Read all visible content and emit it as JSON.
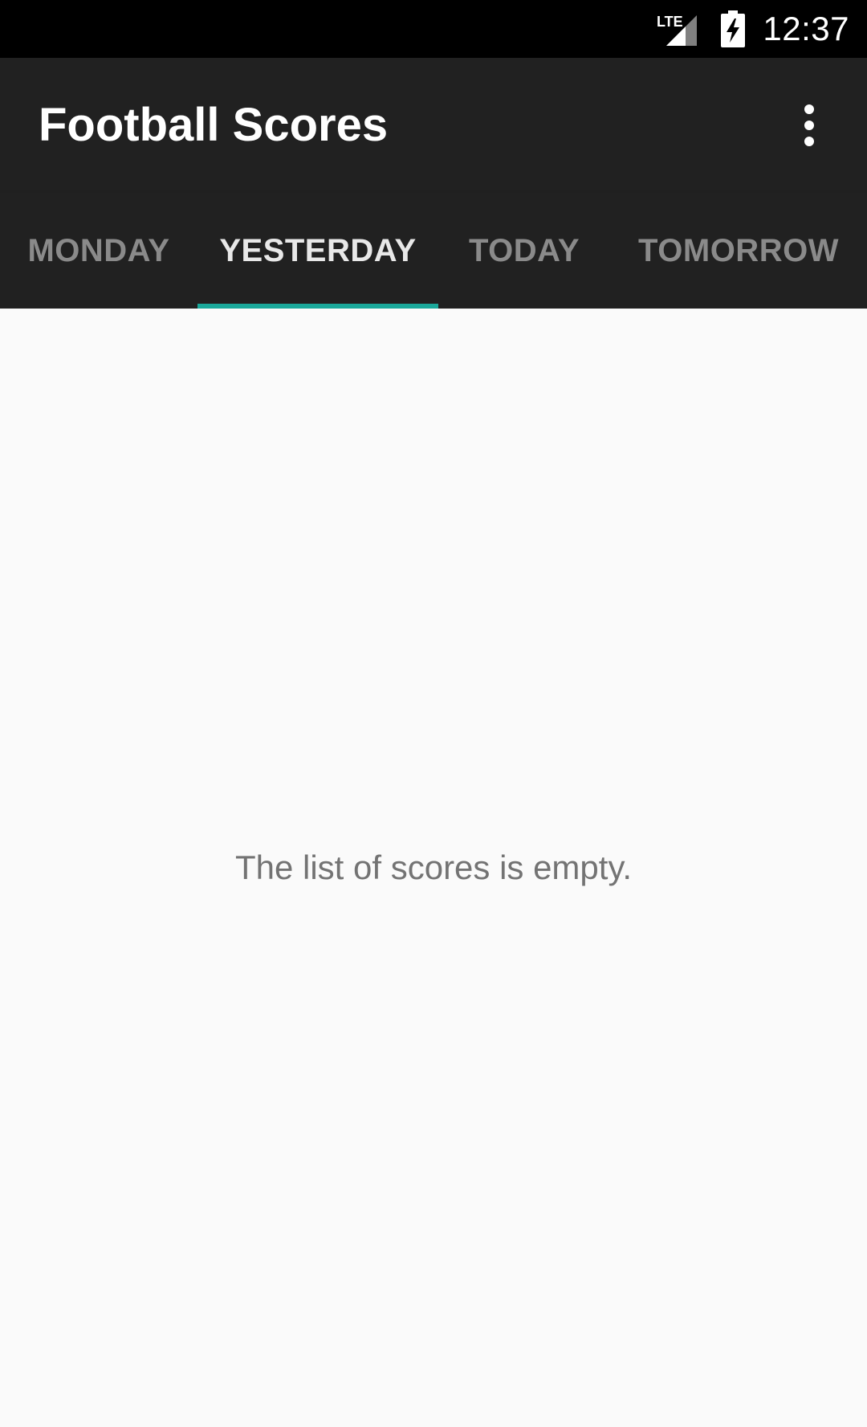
{
  "status_bar": {
    "network_label": "LTE",
    "time": "12:37",
    "icons": [
      "lte-signal-icon",
      "battery-charging-icon"
    ]
  },
  "app_bar": {
    "title": "Football Scores",
    "overflow_icon": "more-vert-icon"
  },
  "tabs": [
    {
      "label": "MONDAY",
      "selected": false
    },
    {
      "label": "YESTERDAY",
      "selected": true
    },
    {
      "label": "TODAY",
      "selected": false
    },
    {
      "label": "TOMORROW",
      "selected": false
    }
  ],
  "content": {
    "empty_message": "The list of scores is empty."
  },
  "colors": {
    "status_bar": "#000000",
    "app_bar": "#212121",
    "tab_indicator": "#1aa89a",
    "background": "#fafafa"
  }
}
